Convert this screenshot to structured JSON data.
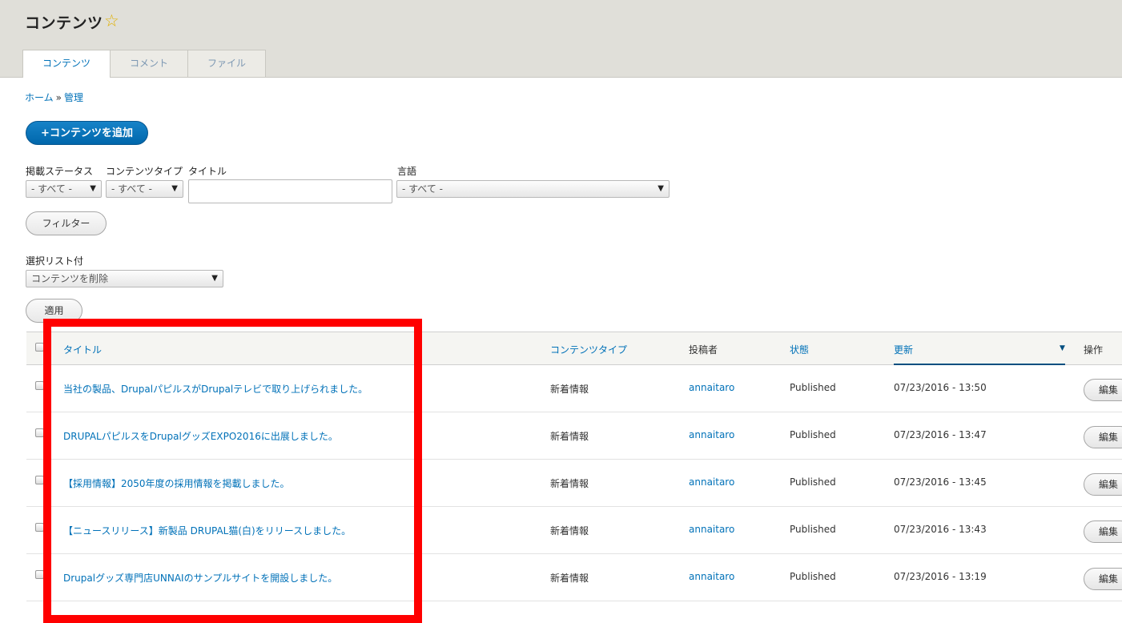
{
  "header": {
    "title": "コンテンツ",
    "star_icon": "star-icon",
    "tabs": [
      {
        "label": "コンテンツ",
        "active": true
      },
      {
        "label": "コメント",
        "active": false
      },
      {
        "label": "ファイル",
        "active": false
      }
    ]
  },
  "breadcrumb": {
    "home": "ホーム",
    "separator": "»",
    "current": "管理"
  },
  "add_button": "+コンテンツを追加",
  "filters": {
    "status_label": "掲載ステータス",
    "status_value": "- すべて -",
    "type_label": "コンテンツタイプ",
    "type_value": "- すべて -",
    "title_label": "タイトル",
    "title_value": "",
    "language_label": "言語",
    "language_value": "- すべて -",
    "filter_button": "フィルター"
  },
  "bulk": {
    "label": "選択リスト付",
    "action_value": "コンテンツを削除",
    "apply_button": "適用"
  },
  "table": {
    "headers": {
      "title": "タイトル",
      "type": "コンテンツタイプ",
      "author": "投稿者",
      "status": "状態",
      "updated": "更新",
      "operations": "操作"
    },
    "rows": [
      {
        "title": "当社の製品、DrupalパピルスがDrupalテレビで取り上げられました。",
        "type": "新着情報",
        "author": "annaitaro",
        "status": "Published",
        "updated": "07/23/2016 - 13:50",
        "edit": "編集"
      },
      {
        "title": "DRUPALパピルスをDrupalグッズEXPO2016に出展しました。",
        "type": "新着情報",
        "author": "annaitaro",
        "status": "Published",
        "updated": "07/23/2016 - 13:47",
        "edit": "編集"
      },
      {
        "title": "【採用情報】2050年度の採用情報を掲載しました。",
        "type": "新着情報",
        "author": "annaitaro",
        "status": "Published",
        "updated": "07/23/2016 - 13:45",
        "edit": "編集"
      },
      {
        "title": "【ニュースリリース】新製品 DRUPAL猫(白)をリリースしました。",
        "type": "新着情報",
        "author": "annaitaro",
        "status": "Published",
        "updated": "07/23/2016 - 13:43",
        "edit": "編集"
      },
      {
        "title": "Drupalグッズ専門店UNNAIのサンプルサイトを開設しました。",
        "type": "新着情報",
        "author": "annaitaro",
        "status": "Published",
        "updated": "07/23/2016 - 13:19",
        "edit": "編集"
      }
    ]
  },
  "colors": {
    "accent": "#0071b8",
    "highlight": "#ff0000",
    "primary_button": "#0074bd"
  }
}
